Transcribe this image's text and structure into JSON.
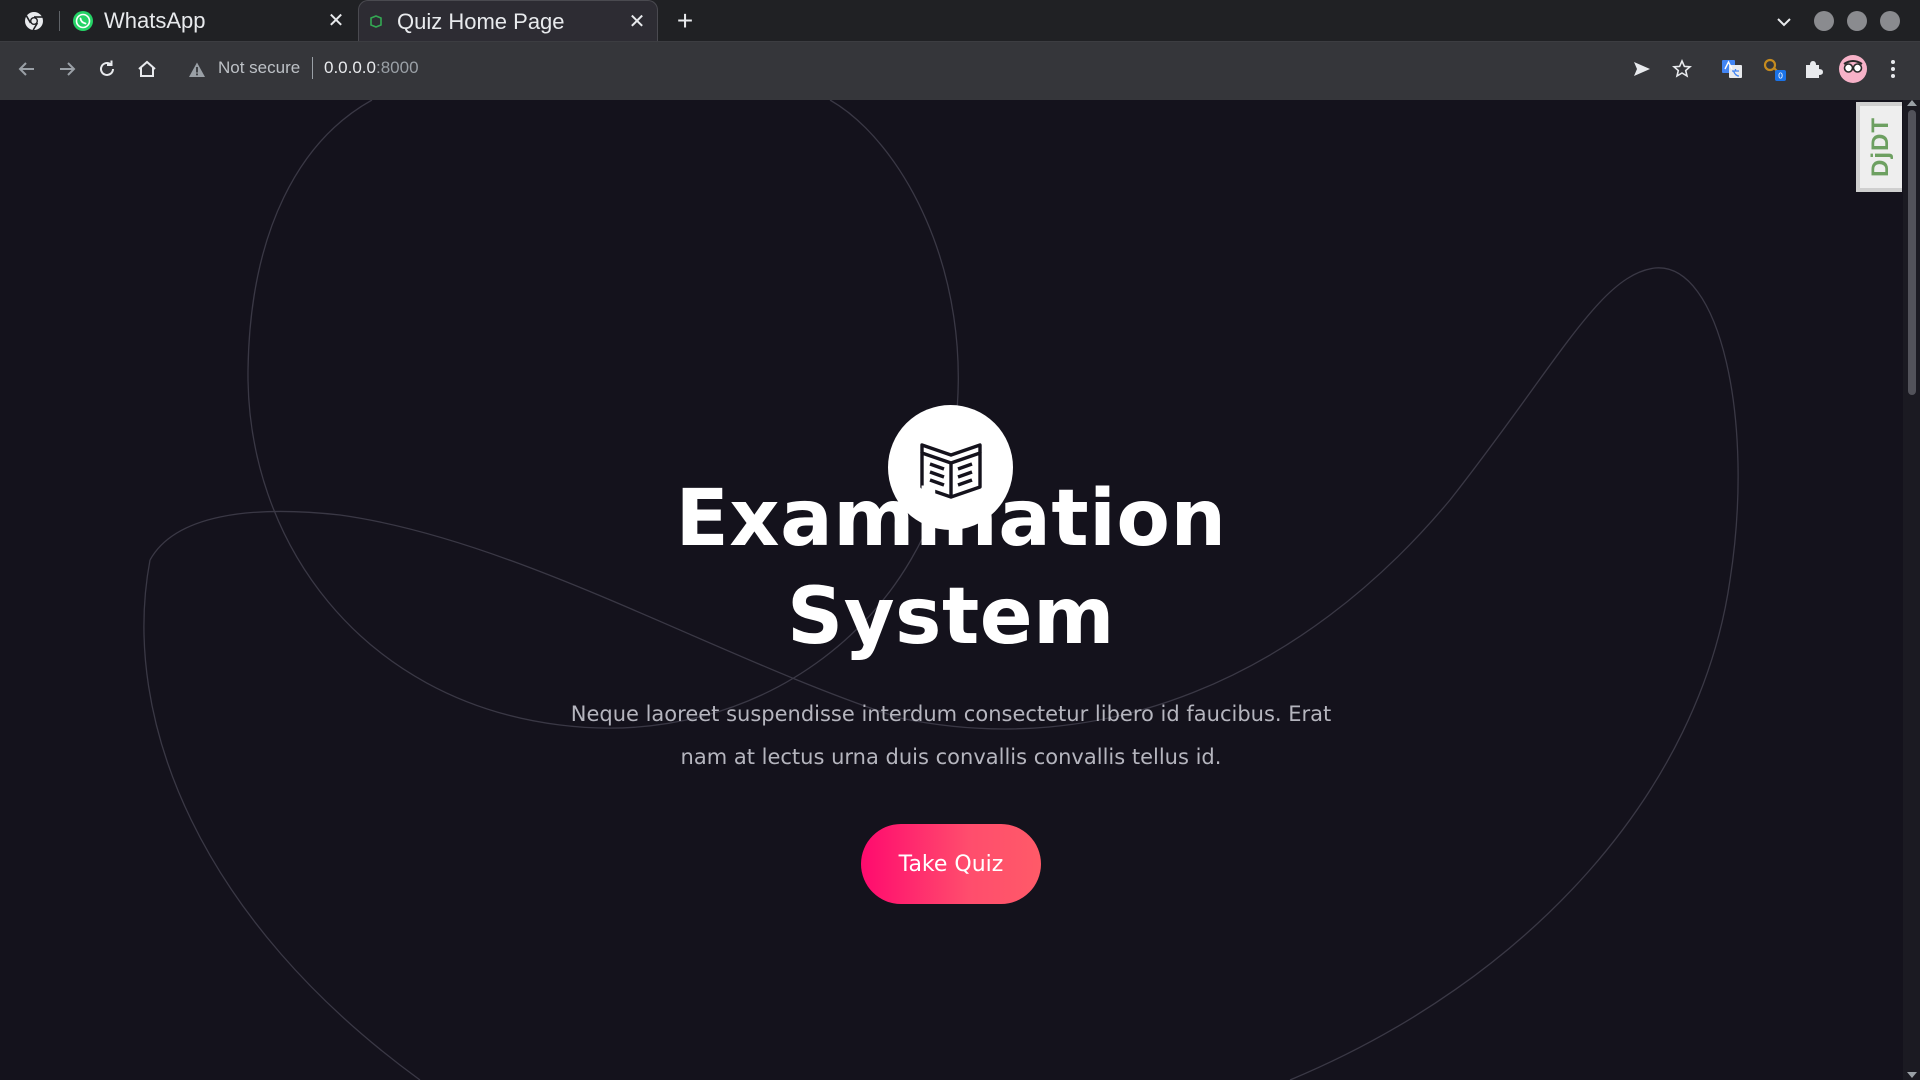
{
  "browser": {
    "tabs": [
      {
        "title": "WhatsApp",
        "favicon": "whatsapp-icon",
        "active": false
      },
      {
        "title": "Quiz Home Page",
        "favicon": "page-favicon",
        "active": true
      }
    ],
    "close_glyph": "✕",
    "new_tab_glyph": "+",
    "omnibox": {
      "security_label": "Not secure",
      "host": "0.0.0.0",
      "port": ":8000"
    },
    "colors": {
      "tabbar_bg": "#202124",
      "toolbar_bg": "#35363a",
      "active_tab_bg": "#2d2c33"
    }
  },
  "debug_toolbar": {
    "label": "DjDT"
  },
  "hero": {
    "logo_icon": "open-book-icon",
    "title_line1": "Examination",
    "title_line2": "System",
    "description": "Neque laoreet suspendisse interdum consectetur libero id faucibus. Erat nam at lectus urna duis convallis convallis tellus id.",
    "cta_label": "Take Quiz"
  },
  "theme": {
    "page_bg": "#14121c",
    "accent_gradient_start": "#ff0a6e",
    "accent_gradient_end": "#ff5a68",
    "text_primary": "#ffffff",
    "text_muted": "#b5b5be"
  }
}
